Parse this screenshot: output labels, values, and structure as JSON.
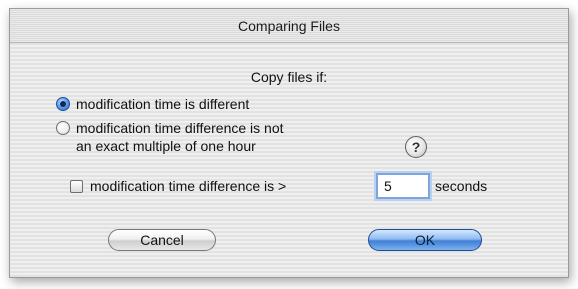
{
  "dialog": {
    "title": "Comparing Files",
    "heading": "Copy files if:"
  },
  "options": {
    "radio_different_label": "modification time is different",
    "radio_different_selected": true,
    "radio_multiple_label_line1": "modification time difference is not",
    "radio_multiple_label_line2": "an exact multiple of one hour",
    "radio_multiple_selected": false,
    "checkbox_label": "modification time difference is >",
    "checkbox_checked": false,
    "seconds_value": "5",
    "seconds_unit": "seconds"
  },
  "help": {
    "glyph": "?",
    "icon": "help-icon"
  },
  "buttons": {
    "cancel_label": "Cancel",
    "ok_label": "OK"
  },
  "colors": {
    "accent": "#3f7fd6"
  }
}
